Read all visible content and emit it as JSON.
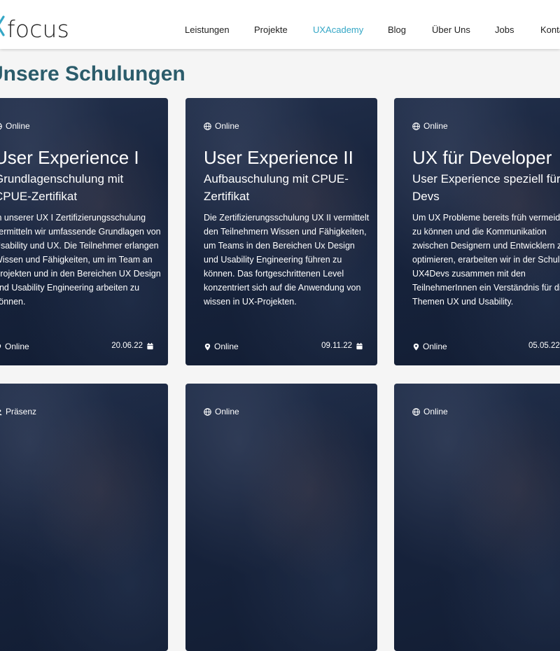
{
  "header": {
    "logo": {
      "text": "focus",
      "icon": "ux-logo-x",
      "accent": "#35a7c6"
    },
    "nav": [
      "Leistungen",
      "Projekte",
      "UXAcademy",
      "Blog",
      "Über Uns",
      "Jobs",
      "Kontakt"
    ],
    "active_nav": "UXAcademy"
  },
  "page": {
    "title": "Unsere Schulungen"
  },
  "cards": [
    {
      "badge": "Online",
      "badge_icon": "globe-icon",
      "title": "User Experience I",
      "subtitle": "Grundlagenschulung mit CPUE-Zertifikat",
      "description": "In unserer UX I Zertifizierungsschulung vermitteln wir umfassende Grundlagen von Usability und UX. Die Teilnehmer erlangen Wissen und Fähigkeiten, um im Team an Projekten und in den Bereichen UX Design und Usability Engineering arbeiten zu können.",
      "location": "Online",
      "date": "20.06.22"
    },
    {
      "badge": "Online",
      "badge_icon": "globe-icon",
      "title": "User Experience II",
      "subtitle": "Aufbauschulung mit CPUE-Zertifikat",
      "description": "Die Zertifizierungsschulung UX II vermittelt den Teilnehmern Wissen und Fähigkeiten, um Teams in den Bereichen Ux Design und Usability Engineering führen zu können. Das fortgeschrittenen Level konzentriert sich auf die Anwendung von wissen in UX-Projekten.",
      "location": "Online",
      "date": "09.11.22"
    },
    {
      "badge": "Online",
      "badge_icon": "globe-icon",
      "title": "UX für Developer",
      "subtitle": "User Experience speziell für Devs",
      "description": "Um UX Probleme bereits früh vermeiden zu können und die Kommunikation zwischen Designern und Entwicklern zu optimieren, erarbeiten wir in der Schulung UX4Devs zusammen mit den TeilnehmerInnen ein Verständnis für die Themen UX und Usability.",
      "location": "Online",
      "date": "05.05.22"
    },
    {
      "badge": "Präsenz",
      "badge_icon": "people-icon"
    },
    {
      "badge": "Online",
      "badge_icon": "globe-icon"
    },
    {
      "badge": "Online",
      "badge_icon": "globe-icon"
    }
  ]
}
